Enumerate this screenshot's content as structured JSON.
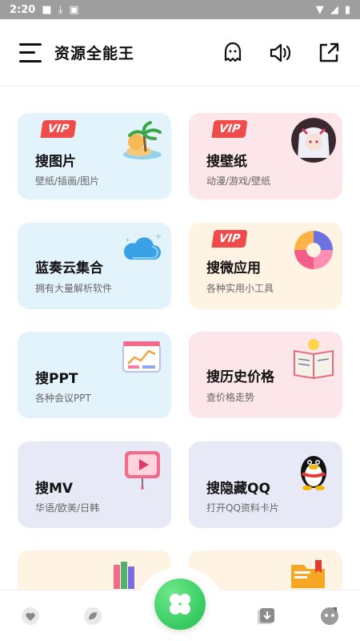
{
  "status_bar": {
    "time": "2:20"
  },
  "header": {
    "title": "资源全能王",
    "menu_icon": "hamburger-menu-icon",
    "actions": [
      "ghost-icon",
      "speaker-icon",
      "share-icon"
    ]
  },
  "badge": "VIP",
  "cards": [
    {
      "title": "搜图片",
      "subtitle": "壁纸/插画/图片",
      "vip": true,
      "bg": "#e3f3fc",
      "icon": "island-illustration"
    },
    {
      "title": "搜壁纸",
      "subtitle": "动漫/游戏/壁纸",
      "vip": true,
      "bg": "#fde6ea",
      "icon": "anime-avatar"
    },
    {
      "title": "蓝奏云集合",
      "subtitle": "拥有大量解析软件",
      "vip": false,
      "bg": "#e3f3fc",
      "icon": "cloud-illustration"
    },
    {
      "title": "搜微应用",
      "subtitle": "各种实用小工具",
      "vip": true,
      "bg": "#fff3e3",
      "icon": "pie-chart-illustration"
    },
    {
      "title": "搜PPT",
      "subtitle": "各种会议PPT",
      "vip": false,
      "bg": "#e3f3fc",
      "icon": "presentation-board-illustration"
    },
    {
      "title": "搜历史价格",
      "subtitle": "查价格走势",
      "vip": false,
      "bg": "#fde6ea",
      "icon": "notebook-lightbulb-illustration"
    },
    {
      "title": "搜MV",
      "subtitle": "华语/欧美/日韩",
      "vip": false,
      "bg": "#e8e9f6",
      "icon": "video-player-illustration"
    },
    {
      "title": "搜隐藏QQ",
      "subtitle": "打开QQ资料卡片",
      "vip": false,
      "bg": "#e8e9f6",
      "icon": "qq-penguin-illustration"
    }
  ],
  "colors": {
    "vip_red": "#f04b4b",
    "accent_green": "#1fbd4f",
    "card_blue": "#e3f3fc",
    "card_pink": "#fde6ea",
    "card_cream": "#fff3e3",
    "card_lavender": "#e8e9f6"
  }
}
